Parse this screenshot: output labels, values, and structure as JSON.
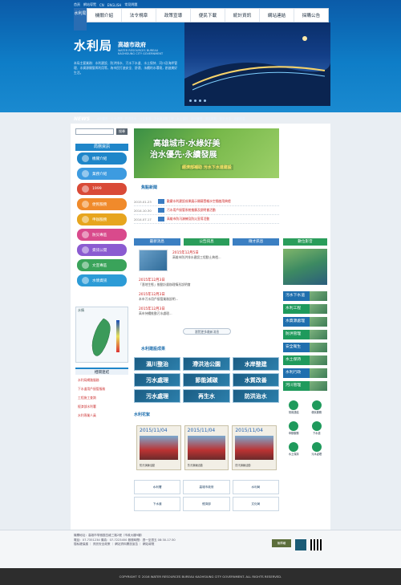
{
  "utility": [
    "首頁",
    "網站導覽",
    "CN",
    "ENGLISH",
    "常見問題"
  ],
  "brand": {
    "side_strip": "水利局",
    "name": "水利局",
    "sub": "高雄市政府",
    "en_line1": "WATER RESOURCES BUREAU",
    "en_line2": "KAOHSIUNG CITY GOVERNMENT",
    "intro": "本局主要業務：水利建設、防洪排水、污水下水道、水土保持、河川及海岸管理、水資源開發與利用等，為市民打造安全、舒適、永續的水環境，創造美好生活。"
  },
  "nav": [
    "機關介紹",
    "法令規章",
    "政策宣導",
    "便民下載",
    "統計資訊",
    "網站連結",
    "採購公告"
  ],
  "ticker": {
    "label": "NEWS",
    "text": "‧ 水利建設 ‧ 污水處理 ‧ 防洪排水 ‧ 公告事項 ‧ 下水道接管工程 ‧ 水土保持 ‧ 河川管理 ‧ 便民服務 ‧ 最新消息 ‧ 活動訊息"
  },
  "search": {
    "placeholder": "",
    "button": "搜尋"
  },
  "left": {
    "title": "局務資訊",
    "menu": [
      {
        "label": "機關介紹",
        "color": "#1f86c9"
      },
      {
        "label": "業務介紹",
        "color": "#3d9be0"
      },
      {
        "label": "1999",
        "color": "#d94a37"
      },
      {
        "label": "便民服務",
        "color": "#f08a2b"
      },
      {
        "label": "申辦服務",
        "color": "#e7a51e"
      },
      {
        "label": "防災專區",
        "color": "#d94a8c"
      },
      {
        "label": "資訊公開",
        "color": "#8b5bd1"
      },
      {
        "label": "文宣專區",
        "color": "#3aa35a"
      },
      {
        "label": "水情資訊",
        "color": "#2c9bd6"
      }
    ],
    "map_title": "水情",
    "links_title": "相關連結",
    "links": [
      "水利局網路服務",
      "下水道用戶接管服務",
      "工程施工查詢",
      "經濟部水利署",
      "水利專業人員"
    ]
  },
  "banner": {
    "line1": "高雄城市‧水綠好美",
    "line2": "治水優先‧永續發展",
    "line3": "經濟部補助 污水下水道建設"
  },
  "news_section": {
    "heading": "焦點新聞",
    "items": [
      {
        "date": "2015.01.23",
        "title": "歡慶水利建設成果展示開幕暨親水空間啟用典禮"
      },
      {
        "date": "2014.10.30",
        "title": "污水用戶接管系統推廣及說明會活動"
      },
      {
        "date": "2014.07.17",
        "title": "高雄市防汛演練及防災宣導活動"
      }
    ]
  },
  "tabs": [
    "最新消息",
    "公告訊息",
    "徵才訊息"
  ],
  "tab_items": [
    {
      "date": "2015年12月5日",
      "title": "高雄市防洪排水建設工程動土典禮..."
    },
    {
      "date": "2015年12月3日",
      "title": "「溼地生態」推動計畫辦理情形說明會"
    },
    {
      "date": "2015年12月3日",
      "title": "本市污水用戶接管業務說明..."
    },
    {
      "date": "2015年12月3日",
      "title": "高市持續推動污水處理..."
    }
  ],
  "more_button": "瀏覽更多最新消息",
  "tiles_heading": "水利建設成果",
  "tiles": [
    "濕川整治",
    "滯洪池公園",
    "水岸整建",
    "污水處理",
    "節能減碳",
    "水質改善",
    "污水處理",
    "再生水",
    "防洪治水"
  ],
  "events": {
    "heading": "水利花絮",
    "items": [
      {
        "date": "2015/11/04",
        "caption": "防汛演練活動"
      },
      {
        "date": "2015/11/04",
        "caption": "防汛演練活動"
      },
      {
        "date": "2015/11/04",
        "caption": "防汛演練活動"
      }
    ]
  },
  "logos": [
    "水利署",
    "高雄市政府",
    "水利局",
    "下水道",
    "經濟部",
    "文化局"
  ],
  "right": {
    "title": "數位影音",
    "menu": [
      {
        "label": "污水下水道",
        "color": "#1f6fae"
      },
      {
        "label": "水利工程",
        "color": "#1f9a5c"
      },
      {
        "label": "水資源處理",
        "color": "#1f6fae"
      },
      {
        "label": "防洪管理",
        "color": "#1f9a5c"
      },
      {
        "label": "安全衛生",
        "color": "#1f6fae"
      },
      {
        "label": "水土保持",
        "color": "#1f9a5c"
      },
      {
        "label": "水利行政",
        "color": "#1f6fae"
      },
      {
        "label": "河川管理",
        "color": "#1f9a5c"
      }
    ],
    "icons": [
      "常用連結",
      "便民服務",
      "申辦服務",
      "下水道",
      "水土保持",
      "污水處理"
    ]
  },
  "footer": {
    "line1": "機關地址：高雄市苓雅區四維三路2號（市政大樓9樓）",
    "line2": "電話：07-7351234  傳真：07-7223450  服務時間：週一至週五 08:30-17:30",
    "line3": "隱私權保護 ｜ 資訊安全政策 ｜ 網站資料開放宣告 ｜ 網站導覽",
    "badge": "無障礙",
    "copyright": "COPYRIGHT © 2016 WATER RESOURCES BUREAU KAOHSIUNG CITY GOVERNMENT. ALL RIGHTS RESERVED."
  }
}
